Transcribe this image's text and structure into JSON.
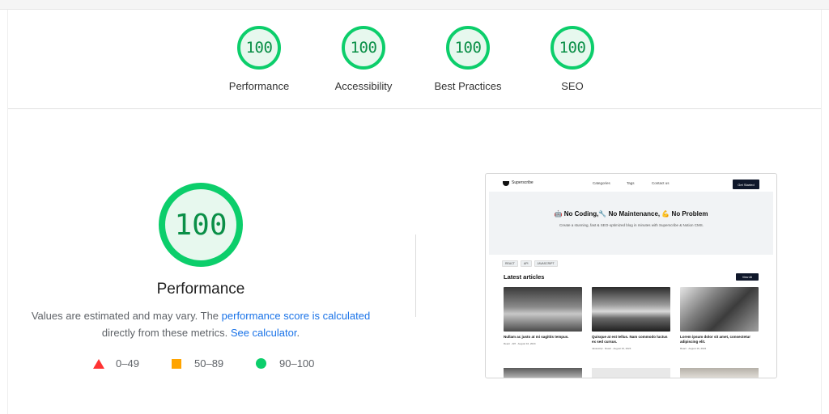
{
  "summary_scores": [
    {
      "label": "Performance",
      "score": "100"
    },
    {
      "label": "Accessibility",
      "score": "100"
    },
    {
      "label": "Best Practices",
      "score": "100"
    },
    {
      "label": "SEO",
      "score": "100"
    }
  ],
  "performance": {
    "score": "100",
    "title": "Performance",
    "desc_prefix": "Values are estimated and may vary. The ",
    "desc_link1": "performance score is calculated",
    "desc_middle": " directly from these metrics. ",
    "desc_link2": "See calculator",
    "desc_suffix": "."
  },
  "legend": {
    "fail": "0–49",
    "average": "50–89",
    "pass": "90–100"
  },
  "colors": {
    "pass": "#0cce6b",
    "average": "#ffa400",
    "fail": "#ff3333",
    "link": "#1a73e8"
  },
  "screenshot": {
    "brand": "Superscribe",
    "nav": [
      "Categories",
      "Tags",
      "Contact us"
    ],
    "cta": "Get Started",
    "hero_title": "🤖 No Coding,🔧 No Maintenance, 💪 No Problem",
    "hero_sub": "Create a stunning, fast & SEO-optimized blog in minutes with Superscribe & Notion CMS.",
    "tags": [
      "REACT",
      "API",
      "JAVASCRIPT"
    ],
    "latest": "Latest articles",
    "view_all": "View All",
    "cards": [
      {
        "title": "Nullam ac justo at mi sagittis tempus.",
        "meta": "React · API · August 16, 2024"
      },
      {
        "title": "Quisque at est tellus. Nam commodo luctus ex sed cursus.",
        "meta": "Javascript · React · August 16, 2024"
      },
      {
        "title": "Lorem ipsum dolor sit amet, consectetur adipiscing elit.",
        "meta": "React · August 16, 2024"
      }
    ]
  }
}
